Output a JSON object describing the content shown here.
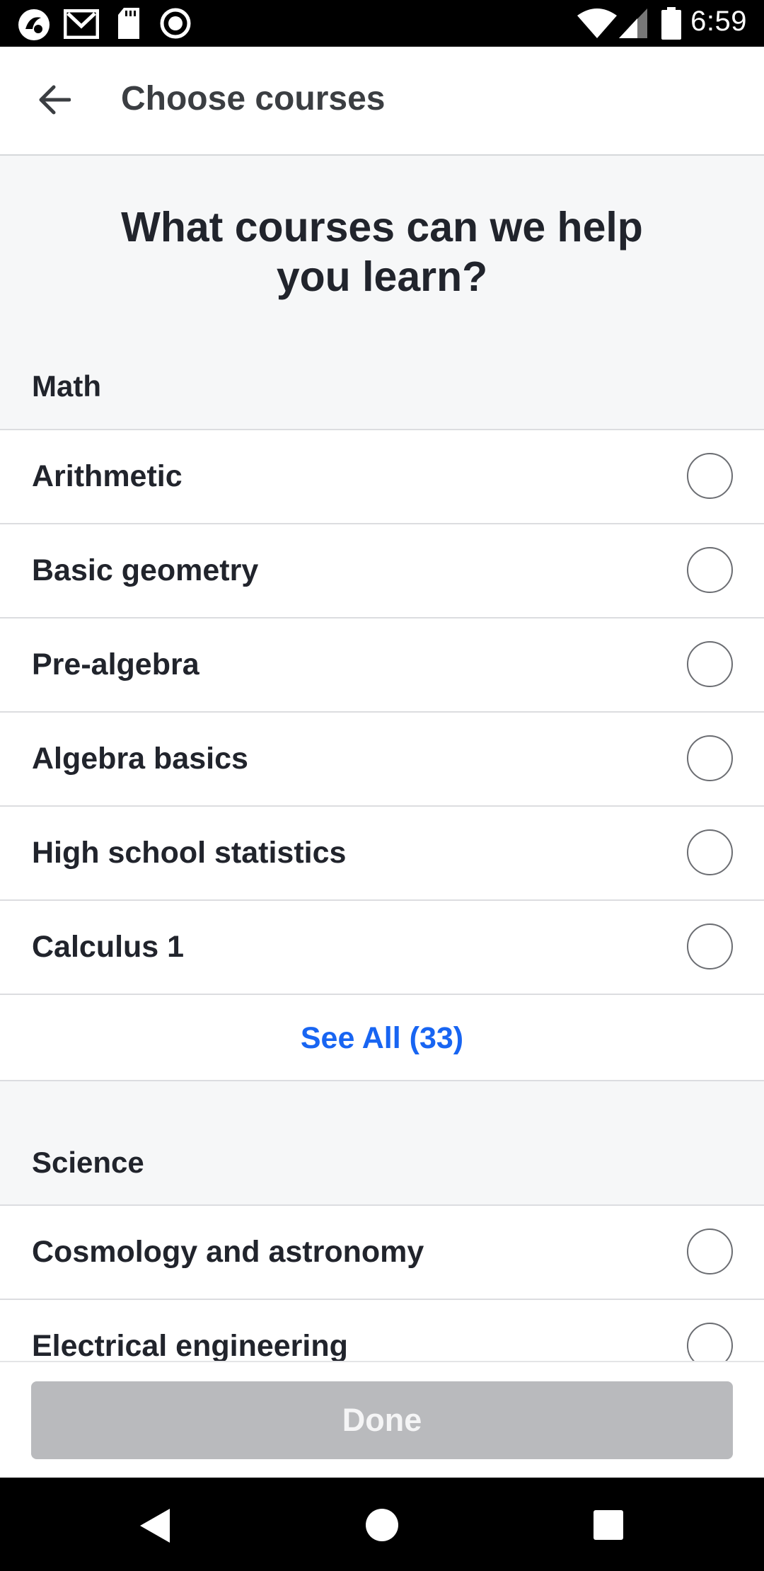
{
  "status_bar": {
    "time": "6:59",
    "left_icons": [
      "app-notification-icon",
      "gmail-icon",
      "sd-card-icon",
      "record-icon"
    ],
    "right_icons": [
      "wifi-icon",
      "cell-signal-icon",
      "battery-icon"
    ]
  },
  "app_bar": {
    "title": "Choose courses",
    "back_icon": "arrow-left-icon"
  },
  "question": {
    "line1": "What courses can we help",
    "line2": "you learn?"
  },
  "sections": [
    {
      "header": "Math",
      "courses": [
        {
          "label": "Arithmetic",
          "selected": false
        },
        {
          "label": "Basic geometry",
          "selected": false
        },
        {
          "label": "Pre-algebra",
          "selected": false
        },
        {
          "label": "Algebra basics",
          "selected": false
        },
        {
          "label": "High school statistics",
          "selected": false
        },
        {
          "label": "Calculus 1",
          "selected": false
        }
      ],
      "see_all": "See All (33)"
    },
    {
      "header": "Science",
      "courses": [
        {
          "label": "Cosmology and astronomy",
          "selected": false
        },
        {
          "label": "Electrical engineering",
          "selected": false
        }
      ]
    }
  ],
  "done_button": {
    "label": "Done",
    "enabled": false
  },
  "colors": {
    "accent": "#1865f2",
    "disabled_button": "#b9babd",
    "background": "#f6f7f8",
    "text": "#21242c"
  },
  "nav_bar": {
    "icons": [
      "nav-back-icon",
      "nav-home-icon",
      "nav-recents-icon"
    ]
  }
}
